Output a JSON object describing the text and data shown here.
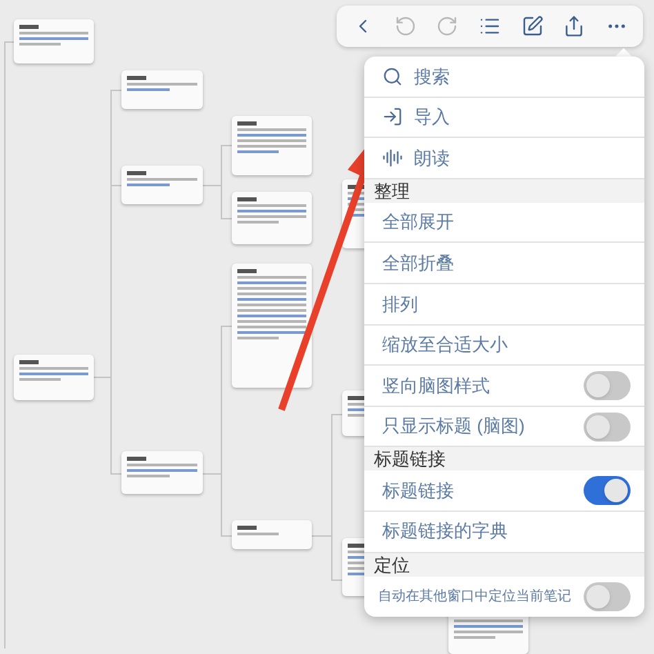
{
  "toolbar": [
    {
      "kind": "back",
      "disabled": false
    },
    {
      "kind": "undo",
      "disabled": true
    },
    {
      "kind": "redo",
      "disabled": true
    },
    {
      "kind": "outline",
      "disabled": false
    },
    {
      "kind": "edit",
      "disabled": false
    },
    {
      "kind": "share",
      "disabled": false
    },
    {
      "kind": "more",
      "disabled": false
    }
  ],
  "menu": [
    {
      "kind": "action",
      "label": "搜索"
    },
    {
      "kind": "action",
      "label": "导入"
    },
    {
      "kind": "action",
      "label": "朗读"
    },
    {
      "kind": "section",
      "label": "整理"
    },
    {
      "kind": "item",
      "label": "全部展开"
    },
    {
      "kind": "item",
      "label": "全部折叠"
    },
    {
      "kind": "item",
      "label": "排列"
    },
    {
      "kind": "item",
      "label": "缩放至合适大小"
    },
    {
      "kind": "toggle",
      "label": "竖向脑图样式",
      "on": false
    },
    {
      "kind": "toggle",
      "label": "只显示标题 (脑图)",
      "on": false
    },
    {
      "kind": "section",
      "label": "标题链接"
    },
    {
      "kind": "toggle",
      "label": "标题链接",
      "on": true
    },
    {
      "kind": "item",
      "label": "标题链接的字典"
    },
    {
      "kind": "section",
      "label": "定位"
    },
    {
      "kind": "toggle",
      "label": "自动在其他窗口中定位当前笔记",
      "on": false
    }
  ]
}
